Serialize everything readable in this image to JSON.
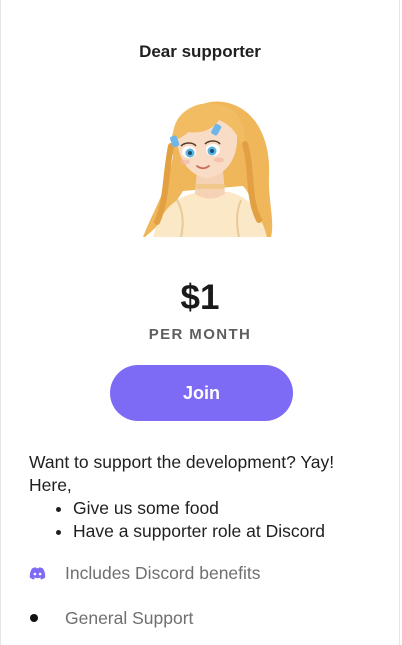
{
  "tier": {
    "title": "Dear supporter",
    "price": "$1",
    "period": "PER MONTH",
    "join_label": "Join",
    "accent_color": "#7d6bf5"
  },
  "description": {
    "intro": "Want to support the development? Yay! Here,",
    "bullets": [
      "Give us some food",
      "Have a supporter role at Discord"
    ]
  },
  "benefits": [
    {
      "icon": "discord-icon",
      "label": "Includes Discord benefits"
    },
    {
      "icon": "bullet-dot-icon",
      "label": "General Support"
    }
  ]
}
